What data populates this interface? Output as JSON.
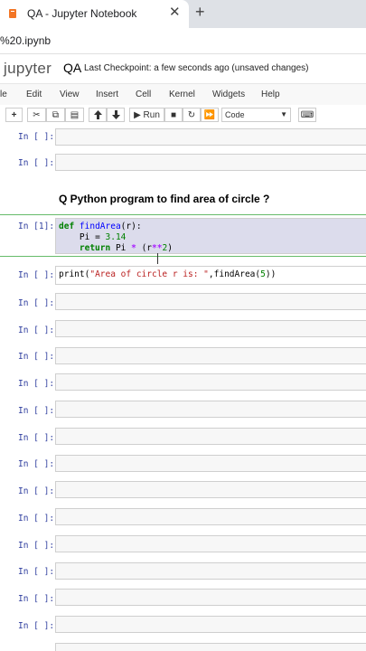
{
  "browser": {
    "tab_title": "QA - Jupyter Notebook",
    "tab_close": "✕",
    "new_tab": "+",
    "url": "%20.ipynb"
  },
  "header": {
    "logo": "jupyter",
    "notebook_name": "QA",
    "checkpoint": "Last Checkpoint: a few seconds ago  (unsaved changes)"
  },
  "menu": [
    "le",
    "Edit",
    "View",
    "Insert",
    "Cell",
    "Kernel",
    "Widgets",
    "Help"
  ],
  "toolbar": {
    "add": "+",
    "cut": "✂",
    "copy": "⧉",
    "paste": "▤",
    "up": "🡅",
    "down": "🡇",
    "run_label": "▶ Run",
    "stop": "■",
    "restart": "↻",
    "fast_forward": "⏩",
    "cell_type": "Code",
    "keyboard": "⌨"
  },
  "cells": {
    "empty_prompt": "In [ ]:",
    "markdown_heading": "Q Python program to find area of circle ?",
    "code1_prompt": "In [1]:",
    "code1": {
      "line1_kw": "def",
      "line1_fn": "findArea",
      "line1_rest": "(r):",
      "line2_var": "Pi",
      "line2_eq": " = ",
      "line2_num": "3.14",
      "line3_kw": "return",
      "line3_rest": " Pi ",
      "line3_op1": "*",
      "line3_paren": " (r",
      "line3_op2": "**",
      "line3_num": "2",
      "line3_close": ")"
    },
    "code2_prompt": "In [ ]:",
    "code2": {
      "print": "print",
      "open": "(",
      "str": "\"Area of circle r is: \"",
      "rest": ",findArea(",
      "num": "5",
      "close": "))"
    }
  }
}
